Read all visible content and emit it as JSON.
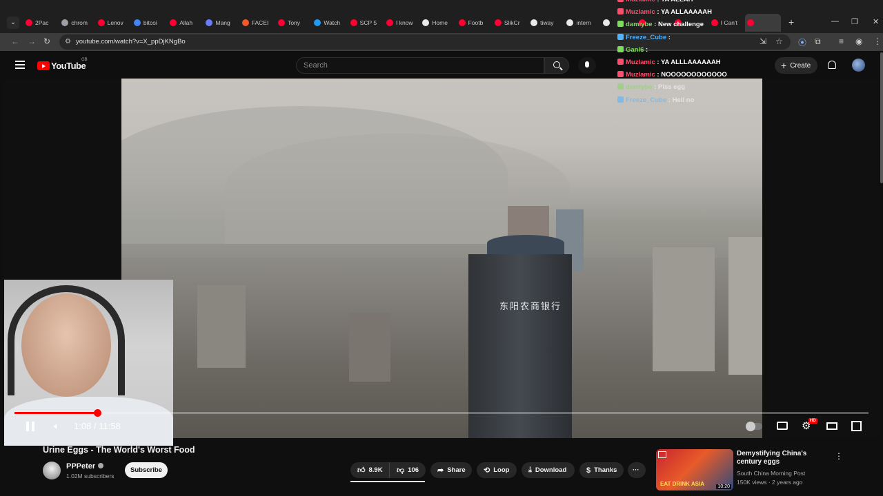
{
  "browser": {
    "tabs": [
      {
        "label": "2Pac",
        "color": "#ff0033"
      },
      {
        "label": "chrom",
        "color": "#9aa0a6"
      },
      {
        "label": "Lenov",
        "color": "#ff0033"
      },
      {
        "label": "bitcoi",
        "color": "#4285f4"
      },
      {
        "label": "Allah",
        "color": "#ff0033"
      },
      {
        "label": "Mang",
        "color": "#6c7cff"
      },
      {
        "label": "FACEI",
        "color": "#f1592a"
      },
      {
        "label": "Tony",
        "color": "#ff0033"
      },
      {
        "label": "Watch",
        "color": "#1d9bf0"
      },
      {
        "label": "SCP 5",
        "color": "#ff0033"
      },
      {
        "label": "I know",
        "color": "#ff0033"
      },
      {
        "label": "Home",
        "color": "#e7e9ea"
      },
      {
        "label": "Footb",
        "color": "#ff0033"
      },
      {
        "label": "SlikCr",
        "color": "#ff0033"
      },
      {
        "label": "tiway",
        "color": "#e7e9ea"
      },
      {
        "label": "intern",
        "color": "#e7e9ea"
      },
      {
        "label": "",
        "color": "#e7e9ea"
      },
      {
        "label": "",
        "color": "#ff0033"
      },
      {
        "label": "",
        "color": "#ff0033"
      },
      {
        "label": "I Can't",
        "color": "#ff0033"
      },
      {
        "label": "",
        "color": "#ff0033"
      }
    ],
    "url": "youtube.com/watch?v=X_ppDjKNgBo"
  },
  "youtube": {
    "logo_text": "YouTube",
    "region": "GB",
    "search_placeholder": "Search",
    "create_label": "Create"
  },
  "chat": [
    {
      "user": "Muzlamic",
      "message": "YA ALLAH",
      "color": "#ff4d6d"
    },
    {
      "user": "Muzlamic",
      "message": "YA ALLAAAAAH",
      "color": "#ff4d6d"
    },
    {
      "user": "damiybe",
      "message": "New challenge",
      "color": "#7ddc5a"
    },
    {
      "user": "Freeze_Cube",
      "message": "",
      "color": "#4fb3ff"
    },
    {
      "user": "Ganl6",
      "message": "",
      "color": "#7ddc5a"
    },
    {
      "user": "Muzlamic",
      "message": "YA ALLLAAAAAAH",
      "color": "#ff4d6d"
    },
    {
      "user": "Muzlamic",
      "message": "NOOOOOOOOOOOO",
      "color": "#ff4d6d"
    },
    {
      "user": "damiybe",
      "message": "Piss egg",
      "color": "#7ddc5a"
    },
    {
      "user": "Freeze_Cube",
      "message": "Hell no",
      "color": "#4fb3ff"
    }
  ],
  "video": {
    "sign_text": "东阳农商银行",
    "progress_fraction": 0.097,
    "time_display": "1:08 / 11:58",
    "hd_badge": "HD",
    "title": "Urine Eggs - The World's Worst Food",
    "channel": "PPPeter",
    "subscribers": "1.02M subscribers",
    "subscribe_label": "Subscribe",
    "likes": "8.9K",
    "dislikes": "106",
    "share_label": "Share",
    "loop_label": "Loop",
    "download_label": "Download",
    "thanks_label": "Thanks",
    "more_label": "···"
  },
  "recommendation": {
    "title": "Demystifying China's century eggs",
    "channel": "South China Morning Post",
    "meta": "150K views · 2 years ago",
    "thumb_text": "EAT DRINK ASIA",
    "duration": "10:20"
  },
  "colors": {
    "accent": "#ff0000",
    "background": "#0f0f0f"
  }
}
